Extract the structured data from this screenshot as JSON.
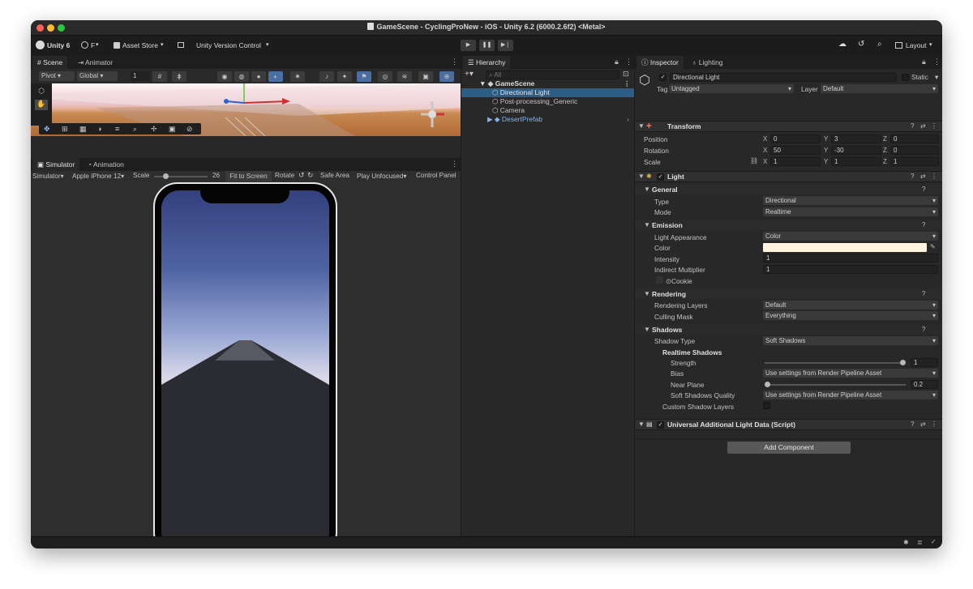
{
  "window": {
    "title": "GameScene - CyclingProNew - iOS - Unity 6.2 (6000.2.6f2) <Metal>"
  },
  "toolbar": {
    "unity_label": "Unity 6",
    "account_label": "F",
    "asset_store_label": "Asset Store",
    "version_control_label": "Unity Version Control",
    "layout_label": "Layout"
  },
  "scene_tabs": {
    "scene": "Scene",
    "animator": "Animator"
  },
  "scene_toolbar": {
    "pivot": "Pivot",
    "global": "Global",
    "grid_value": "1"
  },
  "sim_tabs": {
    "simulator": "Simulator",
    "animation": "Animation"
  },
  "sim_toolbar": {
    "mode": "Simulator",
    "device": "Apple iPhone 12",
    "scale_label": "Scale",
    "scale_value": "26",
    "scale_fraction": 0.18,
    "fit_label": "Fit to Screen",
    "rotate_label": "Rotate",
    "safe_area_label": "Safe Area",
    "play_mode": "Play Unfocused",
    "control_panel_label": "Control Panel"
  },
  "hierarchy": {
    "tab": "Hierarchy",
    "search_placeholder": "All",
    "scene_name": "GameScene",
    "items": [
      {
        "label": "Directional Light"
      },
      {
        "label": "Post-processing_Generic"
      },
      {
        "label": "Camera"
      },
      {
        "label": "DesertPrefab"
      }
    ]
  },
  "inspector": {
    "tab": "Inspector",
    "lighting_tab": "Lighting",
    "object_name": "Directional Light",
    "static_label": "Static",
    "tag_label": "Tag",
    "tag_value": "Untagged",
    "layer_label": "Layer",
    "layer_value": "Default",
    "transform": {
      "title": "Transform",
      "position_label": "Position",
      "rotation_label": "Rotation",
      "scale_label": "Scale",
      "axis_x": "X",
      "axis_y": "Y",
      "axis_z": "Z",
      "position": {
        "x": "0",
        "y": "3",
        "z": "0"
      },
      "rotation": {
        "x": "50",
        "y": "-30",
        "z": "0"
      },
      "scale": {
        "x": "1",
        "y": "1",
        "z": "1"
      }
    },
    "light": {
      "title": "Light",
      "general_label": "General",
      "type_label": "Type",
      "type_value": "Directional",
      "mode_label": "Mode",
      "mode_value": "Realtime",
      "emission_label": "Emission",
      "appearance_label": "Light Appearance",
      "appearance_value": "Color",
      "color_label": "Color",
      "color_value": "#fff4e0",
      "intensity_label": "Intensity",
      "intensity_value": "1",
      "indirect_label": "Indirect Multiplier",
      "indirect_value": "1",
      "cookie_label": "Cookie",
      "rendering_label": "Rendering",
      "rendering_layers_label": "Rendering Layers",
      "rendering_layers_value": "Default",
      "culling_label": "Culling Mask",
      "culling_value": "Everything",
      "shadows_label": "Shadows",
      "shadow_type_label": "Shadow Type",
      "shadow_type_value": "Soft Shadows",
      "realtime_shadows_label": "Realtime Shadows",
      "strength_label": "Strength",
      "strength_value": "1",
      "strength_fraction": 1.0,
      "bias_label": "Bias",
      "bias_value": "Use settings from Render Pipeline Asset",
      "near_plane_label": "Near Plane",
      "near_plane_value": "0.2",
      "near_plane_fraction": 0.0,
      "soft_quality_label": "Soft Shadows Quality",
      "soft_quality_value": "Use settings from Render Pipeline Asset",
      "custom_layers_label": "Custom Shadow Layers"
    },
    "urp": {
      "title": "Universal Additional Light Data (Script)"
    },
    "add_component_label": "Add Component"
  },
  "colors": {
    "selection": "#2c5d87",
    "panel": "#282828",
    "light_color": "#fff4e0"
  }
}
